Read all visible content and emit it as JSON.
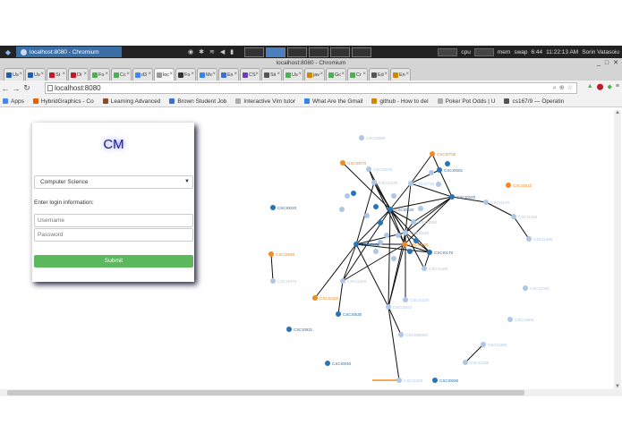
{
  "os": {
    "window_button": "localhost:8080 - Chromium",
    "status": {
      "cpu": "cpu",
      "mem": "mem",
      "swap": "swap",
      "battery": "6:44",
      "clock": "11:22:13 AM",
      "user": "Sorin Vatasoiu"
    }
  },
  "browser": {
    "title": "localhost:8080 - Chromium",
    "tabs": [
      {
        "label": "Us",
        "color": "#1a5fb4"
      },
      {
        "label": "Us",
        "color": "#1a5fb4"
      },
      {
        "label": "St",
        "color": "#c01c28"
      },
      {
        "label": "Di",
        "color": "#c01c28"
      },
      {
        "label": "Fo",
        "color": "#4caf50"
      },
      {
        "label": "Cc",
        "color": "#4caf50"
      },
      {
        "label": "d3",
        "color": "#4285f4"
      },
      {
        "label": "loc",
        "color": "#999999",
        "active": true
      },
      {
        "label": "Fo",
        "color": "#333333"
      },
      {
        "label": "Mc",
        "color": "#3584e4"
      },
      {
        "label": "Ex",
        "color": "#3d6ed5"
      },
      {
        "label": "CS",
        "color": "#6c3fb5"
      },
      {
        "label": "Sii",
        "color": "#555555"
      },
      {
        "label": "Us",
        "color": "#4caf50"
      },
      {
        "label": "jav",
        "color": "#d08800"
      },
      {
        "label": "Gc",
        "color": "#4caf50"
      },
      {
        "label": "Cr",
        "color": "#4caf50"
      },
      {
        "label": "Ed",
        "color": "#555555"
      },
      {
        "label": "En",
        "color": "#d08800"
      }
    ],
    "url": "localhost:8080",
    "bookmarks": [
      {
        "label": "Apps",
        "color": "#4285f4"
      },
      {
        "label": "HybridGraphics - Co",
        "color": "#e66100"
      },
      {
        "label": "Learning Advanced",
        "color": "#8a4c2a"
      },
      {
        "label": "Brown Student Job",
        "color": "#3d6ed5"
      },
      {
        "label": "Interactive Vim tutor",
        "color": "#aaaaaa"
      },
      {
        "label": "What Are the Gmail",
        "color": "#3584e4"
      },
      {
        "label": "github - How to del",
        "color": "#d08800"
      },
      {
        "label": "Poker Pot Odds | U",
        "color": "#aaaaaa"
      },
      {
        "label": "cs167/9 — Operatin",
        "color": "#555555"
      }
    ]
  },
  "login": {
    "logo": "CM",
    "department": "Computer Science",
    "prompt": "Enter login information:",
    "username_placeholder": "Username",
    "password_placeholder": "Password",
    "submit_label": "Submit"
  },
  "graph": {
    "colors": {
      "orange": "#f28b22",
      "blue": "#2874b8",
      "light": "#aec7e8"
    },
    "nodes": [
      {
        "id": "n1",
        "label": "CSCI0090",
        "kind": "light"
      },
      {
        "id": "n2",
        "label": "CSCI0730",
        "kind": "orange"
      },
      {
        "id": "n3",
        "label": "CSCI0081",
        "kind": "blue"
      },
      {
        "id": "n4",
        "label": "CSCI0070",
        "kind": "orange"
      },
      {
        "id": "n5",
        "label": "CSCI1570",
        "kind": "light"
      },
      {
        "id": "n6",
        "label": "CSCI1370",
        "kind": "light"
      },
      {
        "id": "n7",
        "label": "CSCI1730",
        "kind": "light"
      },
      {
        "id": "n8",
        "label": "CSCI2510",
        "kind": "orange"
      },
      {
        "id": "n9",
        "label": "CSCI0220",
        "kind": "blue"
      },
      {
        "id": "n10",
        "label": "CSCI1570",
        "kind": "light"
      },
      {
        "id": "n11",
        "label": "CSCI0020",
        "kind": "blue"
      },
      {
        "id": "n12",
        "label": "CSCI0320",
        "kind": "blue"
      },
      {
        "id": "n13",
        "label": "CSCI1450",
        "kind": "light"
      },
      {
        "id": "n14",
        "label": "CSCI1550",
        "kind": "light"
      },
      {
        "id": "n15",
        "label": "CSCI0150",
        "kind": "light"
      },
      {
        "id": "n16",
        "label": "CSCI0160",
        "kind": "orange"
      },
      {
        "id": "n17",
        "label": "CSCI0170",
        "kind": "blue"
      },
      {
        "id": "n18",
        "label": "CSCI1460",
        "kind": "light"
      },
      {
        "id": "n19",
        "label": "CSCI0180",
        "kind": "blue"
      },
      {
        "id": "n20",
        "label": "CSCI2590",
        "kind": "orange"
      },
      {
        "id": "n21",
        "label": "CSCI1480",
        "kind": "light"
      },
      {
        "id": "n22",
        "label": "CSCI1070",
        "kind": "light"
      },
      {
        "id": "n23",
        "label": "CSCI1420",
        "kind": "light"
      },
      {
        "id": "n24",
        "label": "CSCI1780",
        "kind": "light"
      },
      {
        "id": "n25",
        "label": "CSCI2420",
        "kind": "orange"
      },
      {
        "id": "n26",
        "label": "CSCI1234",
        "kind": "light"
      },
      {
        "id": "n27",
        "label": "CSCI0530",
        "kind": "blue"
      },
      {
        "id": "n28",
        "label": "CSCI1672",
        "kind": "light"
      },
      {
        "id": "n29",
        "label": "CSCI1800",
        "kind": "light"
      },
      {
        "id": "n30",
        "label": "CSCI0931",
        "kind": "blue"
      },
      {
        "id": "n31",
        "label": "CSCI0950N",
        "kind": "light"
      },
      {
        "id": "n32",
        "label": "CSCI1380",
        "kind": "light"
      },
      {
        "id": "n33",
        "label": "CSCI0040",
        "kind": "blue"
      },
      {
        "id": "n34",
        "label": "CSCI1230",
        "kind": "light"
      },
      {
        "id": "n35",
        "label": "CSCI1300",
        "kind": "light"
      },
      {
        "id": "n36",
        "label": "CSCI0080",
        "kind": "blue"
      }
    ]
  }
}
